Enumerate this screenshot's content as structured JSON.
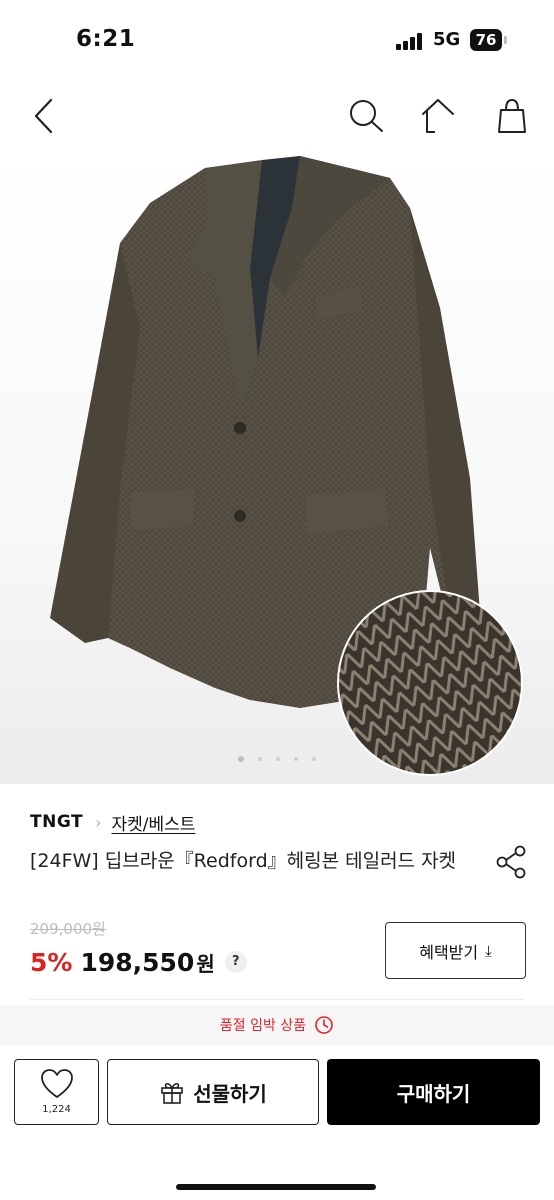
{
  "status_bar": {
    "time": "6:21",
    "network": "5G",
    "battery": "76"
  },
  "nav": {
    "back_icon": "chevron-left-icon",
    "search_icon": "search-icon",
    "home_icon": "home-icon",
    "cart_icon": "shopping-bag-icon"
  },
  "product": {
    "image_description_icon": "jacket-photo",
    "pager": {
      "current": 1,
      "total": 5
    },
    "brand": "TNGT",
    "category": "자켓/베스트",
    "title": "[24FW] 딥브라운『Redford』헤링본 테일러드 자켓",
    "original_price": "209,000원",
    "discount": "5%",
    "sale_price": "198,550",
    "sale_unit": "원",
    "help_label": "?",
    "coupon_label": "혜택받기",
    "coupon_icon": "download-icon"
  },
  "notice": {
    "text": "품절 임박 상품",
    "icon": "clock-icon",
    "color": "#e0262e"
  },
  "actions": {
    "like_count": "1,224",
    "gift_label": "선물하기",
    "buy_label": "구매하기"
  },
  "colors": {
    "accent": "#e02020",
    "buy_button": "#000000"
  }
}
